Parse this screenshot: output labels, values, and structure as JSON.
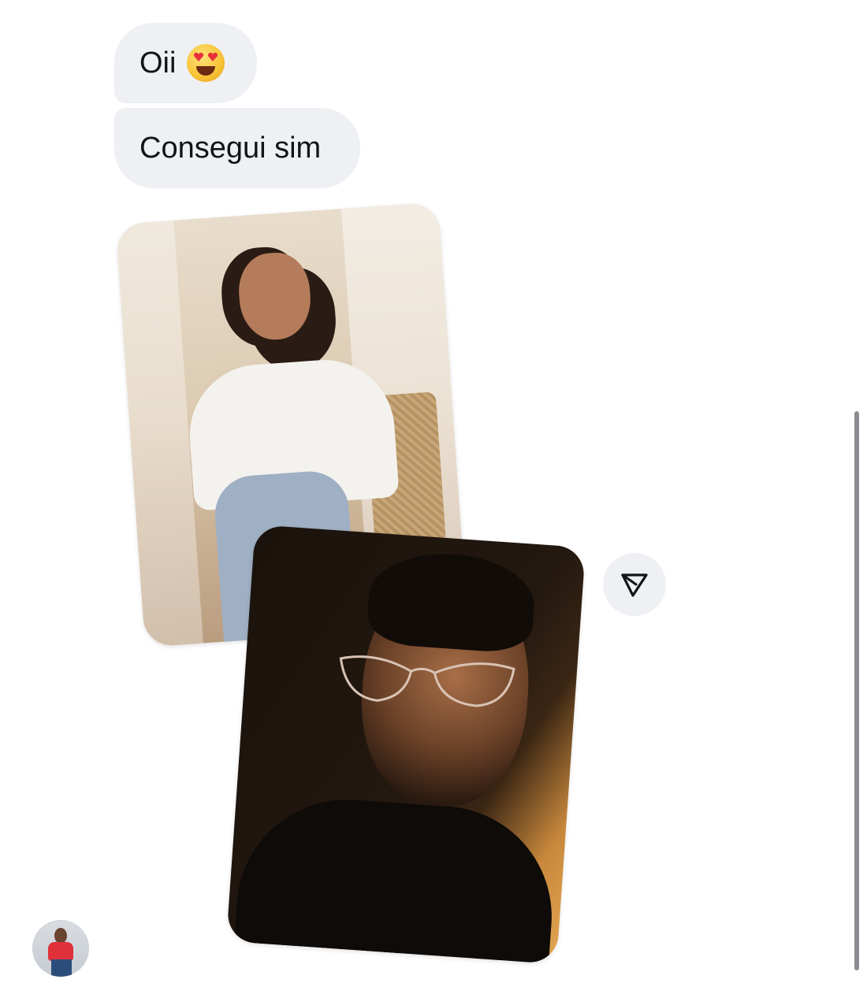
{
  "messages": [
    {
      "text": "Oii",
      "emoji": "heart-eyes-emoji"
    },
    {
      "text": "Consegui sim"
    }
  ],
  "shared_photos": [
    {
      "subject": "woman-in-white-shirt-on-chair"
    },
    {
      "subject": "woman-in-glasses-black-turtleneck"
    }
  ],
  "icons": {
    "forward": "forward-icon",
    "avatar": "sender-avatar"
  },
  "colors": {
    "bubble_bg": "#eef0f3",
    "text": "#111418",
    "scrollbar": "#8a8d91"
  }
}
